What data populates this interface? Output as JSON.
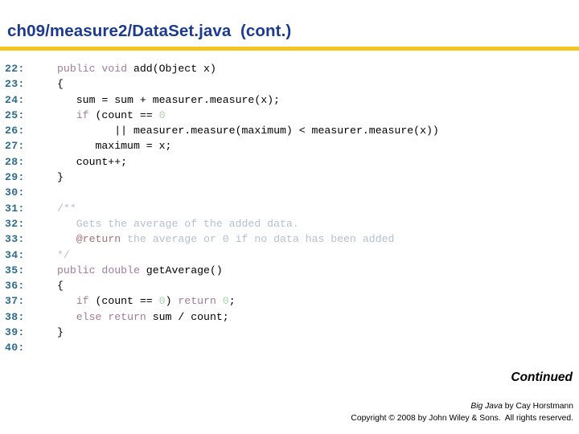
{
  "slide": {
    "title": "ch09/measure2/DataSet.java  (cont.)",
    "accent_color": "#F2C61E",
    "title_color": "#1C3A8E"
  },
  "code": {
    "line_number_color": "#2E6B8E",
    "keyword_color": "#A07C9B",
    "comment_color": "#B7BDD2",
    "literal_color": "#A8D5A8",
    "javadoc_tag_color": "#A5717E",
    "lines": [
      {
        "no": "22:",
        "segments": [
          {
            "t": "public",
            "c": "kw"
          },
          {
            "t": " "
          },
          {
            "t": "void",
            "c": "kw"
          },
          {
            "t": " add(Object x)"
          }
        ]
      },
      {
        "no": "23:",
        "segments": [
          {
            "t": "{"
          }
        ]
      },
      {
        "no": "24:",
        "segments": [
          {
            "t": "   sum = sum + measurer.measure(x);"
          }
        ]
      },
      {
        "no": "25:",
        "segments": [
          {
            "t": "   "
          },
          {
            "t": "if",
            "c": "kw"
          },
          {
            "t": " (count == "
          },
          {
            "t": "0",
            "c": "num"
          }
        ]
      },
      {
        "no": "26:",
        "segments": [
          {
            "t": "         || measurer.measure(maximum) < measurer.measure(x))"
          }
        ]
      },
      {
        "no": "27:",
        "segments": [
          {
            "t": "      maximum = x;"
          }
        ]
      },
      {
        "no": "28:",
        "segments": [
          {
            "t": "   count++;"
          }
        ]
      },
      {
        "no": "29:",
        "segments": [
          {
            "t": "}"
          }
        ]
      },
      {
        "no": "30:",
        "segments": [
          {
            "t": ""
          }
        ]
      },
      {
        "no": "31:",
        "segments": [
          {
            "t": "/**",
            "c": "cmt"
          }
        ]
      },
      {
        "no": "32:",
        "segments": [
          {
            "t": "   Gets the average of the added data.",
            "c": "cmt"
          }
        ]
      },
      {
        "no": "33:",
        "segments": [
          {
            "t": "   "
          },
          {
            "t": "@return",
            "c": "tag"
          },
          {
            "t": " the average or 0 if no data has been added",
            "c": "cmt"
          }
        ]
      },
      {
        "no": "34:",
        "segments": [
          {
            "t": "*/",
            "c": "cmt"
          }
        ]
      },
      {
        "no": "35:",
        "segments": [
          {
            "t": "public",
            "c": "kw"
          },
          {
            "t": " "
          },
          {
            "t": "double",
            "c": "kw"
          },
          {
            "t": " getAverage()"
          }
        ]
      },
      {
        "no": "36:",
        "segments": [
          {
            "t": "{"
          }
        ]
      },
      {
        "no": "37:",
        "segments": [
          {
            "t": "   "
          },
          {
            "t": "if",
            "c": "kw"
          },
          {
            "t": " (count == "
          },
          {
            "t": "0",
            "c": "num"
          },
          {
            "t": ") "
          },
          {
            "t": "return",
            "c": "kw"
          },
          {
            "t": " "
          },
          {
            "t": "0",
            "c": "num"
          },
          {
            "t": ";"
          }
        ]
      },
      {
        "no": "38:",
        "segments": [
          {
            "t": "   "
          },
          {
            "t": "else",
            "c": "kw"
          },
          {
            "t": " "
          },
          {
            "t": "return",
            "c": "kw"
          },
          {
            "t": " sum / count;"
          }
        ]
      },
      {
        "no": "39:",
        "segments": [
          {
            "t": "}"
          }
        ]
      },
      {
        "no": "40:",
        "segments": [
          {
            "t": ""
          }
        ]
      }
    ]
  },
  "footer": {
    "continued": "Continued",
    "book_title": "Big Java",
    "credit_rest": " by Cay Horstmann",
    "copyright": "Copyright © 2008 by John Wiley & Sons.  All rights reserved."
  }
}
